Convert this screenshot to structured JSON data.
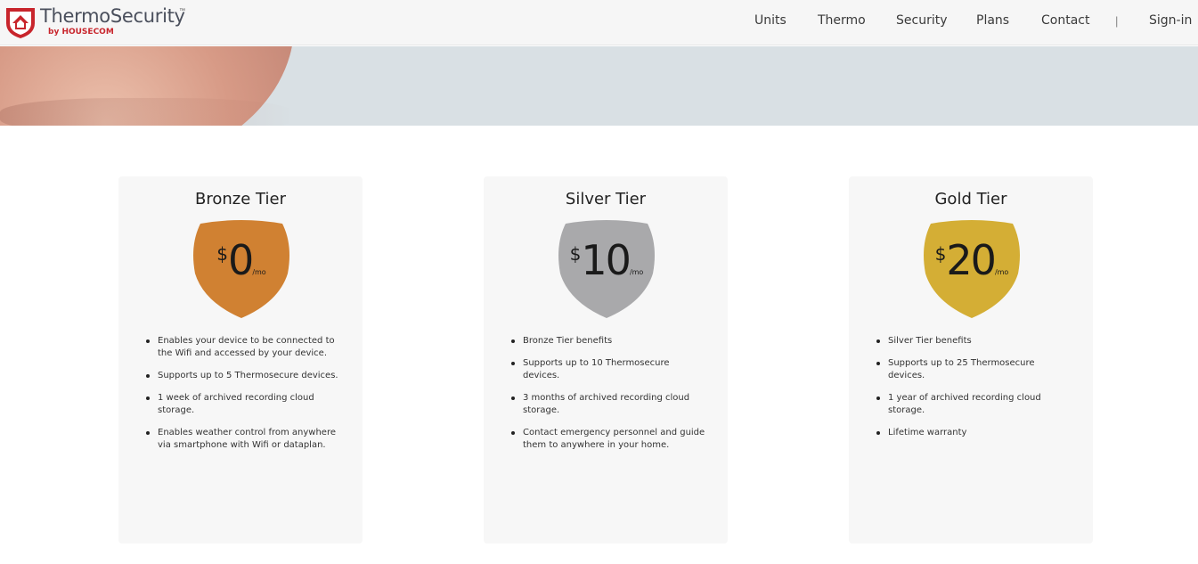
{
  "brand": {
    "title": "ThermoSecurity",
    "tm": "™",
    "sub": "by HOUSECOM",
    "colors": {
      "shield": "#c8252c",
      "text": "#4a4f5c"
    }
  },
  "nav": {
    "items": [
      "Units",
      "Thermo",
      "Security",
      "Plans",
      "Contact"
    ],
    "separator": "|",
    "signin": "Sign-in"
  },
  "plans": [
    {
      "title": "Bronze Tier",
      "currency": "$",
      "amount": "0",
      "period": "/mo",
      "color": "#d08132",
      "features": [
        "Enables your device to be connected to the Wifi and accessed by your device.",
        "Supports up to 5 Thermosecure devices.",
        "1 week of archived recording cloud storage.",
        "Enables weather control from anywhere via smartphone with Wifi or dataplan."
      ]
    },
    {
      "title": "Silver Tier",
      "currency": "$",
      "amount": "10",
      "period": "/mo",
      "color": "#a9a9ab",
      "features": [
        "Bronze Tier benefits",
        "Supports up to 10 Thermosecure devices.",
        "3 months of archived recording cloud storage.",
        "Contact emergency personnel and guide them to anywhere in your home."
      ]
    },
    {
      "title": "Gold Tier",
      "currency": "$",
      "amount": "20",
      "period": "/mo",
      "color": "#d4ae35",
      "features": [
        "Silver Tier benefits",
        "Supports up to 25 Thermosecure devices.",
        "1 year of archived recording cloud storage.",
        "Lifetime warranty"
      ]
    }
  ]
}
